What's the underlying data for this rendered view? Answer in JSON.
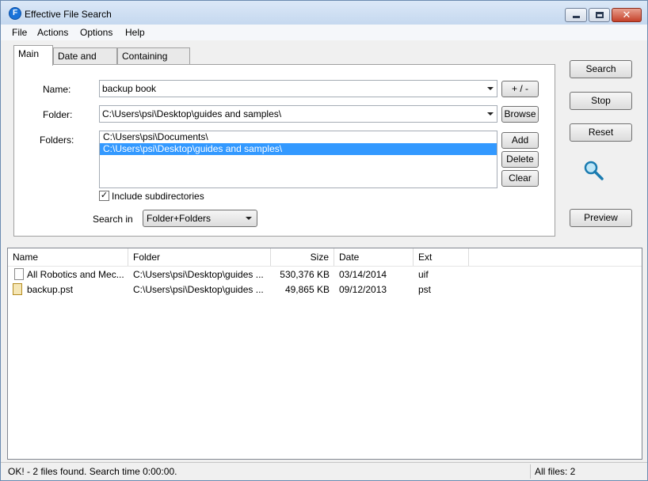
{
  "window": {
    "title": "Effective File Search",
    "icon_letter": "F"
  },
  "window_controls": {
    "minimize": "minimize-icon",
    "maximize": "maximize-icon",
    "close": "✕"
  },
  "menu": [
    "File",
    "Actions",
    "Options",
    "Help"
  ],
  "tabs": [
    {
      "label": "Main",
      "active": true
    },
    {
      "label": "Date and size",
      "active": false
    },
    {
      "label": "Containing text",
      "active": false
    }
  ],
  "form": {
    "name_label": "Name:",
    "name_value": "backup book",
    "plusminus_label": "+ / -",
    "folder_label": "Folder:",
    "folder_value": "C:\\Users\\psi\\Desktop\\guides and samples\\",
    "browse_label": "Browse",
    "folders_label": "Folders:",
    "folders_list": [
      {
        "path": "C:\\Users\\psi\\Documents\\",
        "selected": false
      },
      {
        "path": "C:\\Users\\psi\\Desktop\\guides and samples\\",
        "selected": true
      }
    ],
    "add_label": "Add",
    "delete_label": "Delete",
    "clear_label": "Clear",
    "include_subdirs_label": "Include subdirectories",
    "include_subdirs_checked": true,
    "search_in_label": "Search in",
    "search_in_value": "Folder+Folders"
  },
  "side_buttons": {
    "search": "Search",
    "stop": "Stop",
    "reset": "Reset",
    "preview": "Preview"
  },
  "results": {
    "columns": [
      "Name",
      "Folder",
      "Size",
      "Date",
      "Ext"
    ],
    "rows": [
      {
        "name": "All Robotics and Mec...",
        "folder": "C:\\Users\\psi\\Desktop\\guides ...",
        "size": "530,376 KB",
        "date": "03/14/2014",
        "ext": "uif",
        "icon": "document-icon"
      },
      {
        "name": "backup.pst",
        "folder": "C:\\Users\\psi\\Desktop\\guides ...",
        "size": "49,865 KB",
        "date": "09/12/2013",
        "ext": "pst",
        "icon": "pst-file-icon"
      }
    ]
  },
  "status": {
    "message": "OK! - 2 files found. Search time 0:00:00.",
    "all_files": "All files: 2"
  },
  "colors": {
    "selection": "#3399ff",
    "title_gradient": "#c5d8ef",
    "close_button": "#c5412a"
  }
}
